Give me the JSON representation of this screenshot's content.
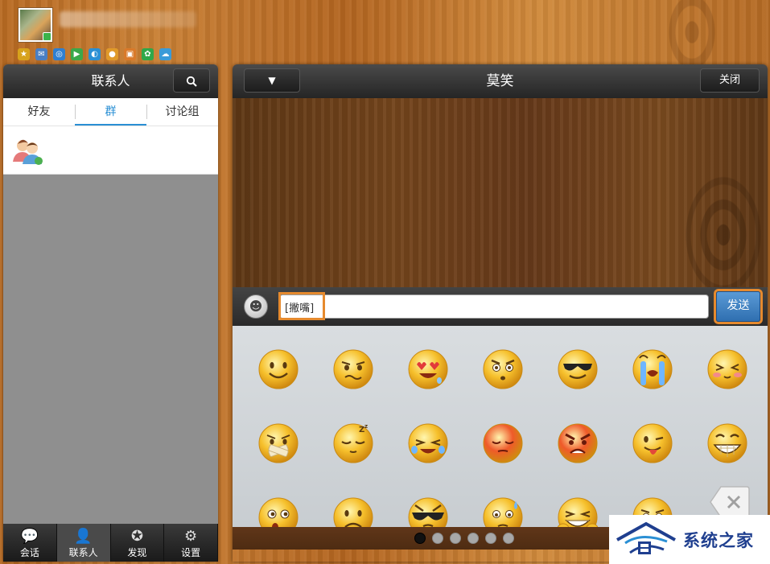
{
  "header": {
    "nickname": "",
    "app_icons": [
      {
        "icon": "star-icon",
        "glyph": "★",
        "color": "#d7a21c"
      },
      {
        "icon": "mail-icon",
        "glyph": "✉",
        "color": "#4a7fc4"
      },
      {
        "icon": "search-engine-icon",
        "glyph": "◎",
        "color": "#2f7fd1"
      },
      {
        "icon": "video-icon",
        "glyph": "▶",
        "color": "#3aa84a"
      },
      {
        "icon": "browser-icon",
        "glyph": "◐",
        "color": "#2a8fd4"
      },
      {
        "icon": "game-icon",
        "glyph": "●",
        "color": "#e09a2a"
      },
      {
        "icon": "wallet-icon",
        "glyph": "▣",
        "color": "#d97a2a"
      },
      {
        "icon": "clover-icon",
        "glyph": "✿",
        "color": "#2fa84a"
      },
      {
        "icon": "cloud-icon",
        "glyph": "☁",
        "color": "#3a9bd8"
      }
    ]
  },
  "contacts": {
    "title": "联系人",
    "tabs": [
      {
        "label": "好友",
        "active": false
      },
      {
        "label": "群",
        "active": true
      },
      {
        "label": "讨论组",
        "active": false
      }
    ]
  },
  "bottom_nav": [
    {
      "label": "会话",
      "icon": "chat-bubble-icon",
      "glyph": "💬",
      "active": false
    },
    {
      "label": "联系人",
      "icon": "person-icon",
      "glyph": "👤",
      "active": true
    },
    {
      "label": "发现",
      "icon": "discover-star-icon",
      "glyph": "✪",
      "active": false
    },
    {
      "label": "设置",
      "icon": "gear-icon",
      "glyph": "⚙",
      "active": false
    }
  ],
  "chat": {
    "title": "莫笑",
    "menu_glyph": "▼",
    "close_label": "关闭",
    "input_value": "[撇嘴]",
    "send_label": "发送",
    "emojis": [
      "smile",
      "worried",
      "heart-eyes",
      "dizzy",
      "cool-sunglasses",
      "crying",
      "shy",
      "silenced",
      "sleepy",
      "laugh-tears",
      "blush-red",
      "angry-red",
      "tongue-wink",
      "grin",
      "surprised",
      "sad",
      "sunglasses-cool",
      "sweat",
      "awkward-laugh",
      "confused"
    ],
    "pages": 6,
    "active_page": 0
  },
  "watermark": {
    "text": "系统之家"
  },
  "colors": {
    "accent_blue": "#2a8fd4",
    "highlight_orange": "#e68a2e",
    "send_blue": "#3f7fc0",
    "emoji_yellow": "#f6c02c"
  }
}
